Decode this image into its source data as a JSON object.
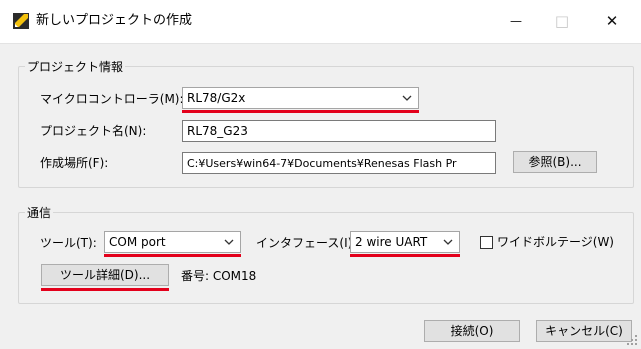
{
  "window": {
    "title": "新しいプロジェクトの作成",
    "minimize_glyph": "—",
    "maximize_glyph": "□",
    "close_glyph": "✕"
  },
  "project_info": {
    "legend": "プロジェクト情報",
    "microcontroller": {
      "label": "マイクロコントローラ(M):",
      "value": "RL78/G2x"
    },
    "project_name": {
      "label": "プロジェクト名(N):",
      "value": "RL78_G23"
    },
    "location": {
      "label": "作成場所(F):",
      "value": "C:¥Users¥win64-7¥Documents¥Renesas Flash Pr",
      "browse_button": "参照(B)..."
    }
  },
  "communication": {
    "legend": "通信",
    "tool": {
      "label": "ツール(T):",
      "value": "COM port"
    },
    "interface": {
      "label": "インタフェース(I):",
      "value": "2 wire UART"
    },
    "wide_voltage": {
      "label": "ワイドボルテージ(W)",
      "checked": false
    },
    "tool_details_button": "ツール詳細(D)...",
    "port_number": "番号: COM18"
  },
  "footer": {
    "connect_button": "接続(O)",
    "cancel_button": "キャンセル(C)"
  },
  "colors": {
    "highlight": "#e3001b",
    "title_bg": "#ffffff",
    "dialog_bg": "#f0f0f0"
  }
}
